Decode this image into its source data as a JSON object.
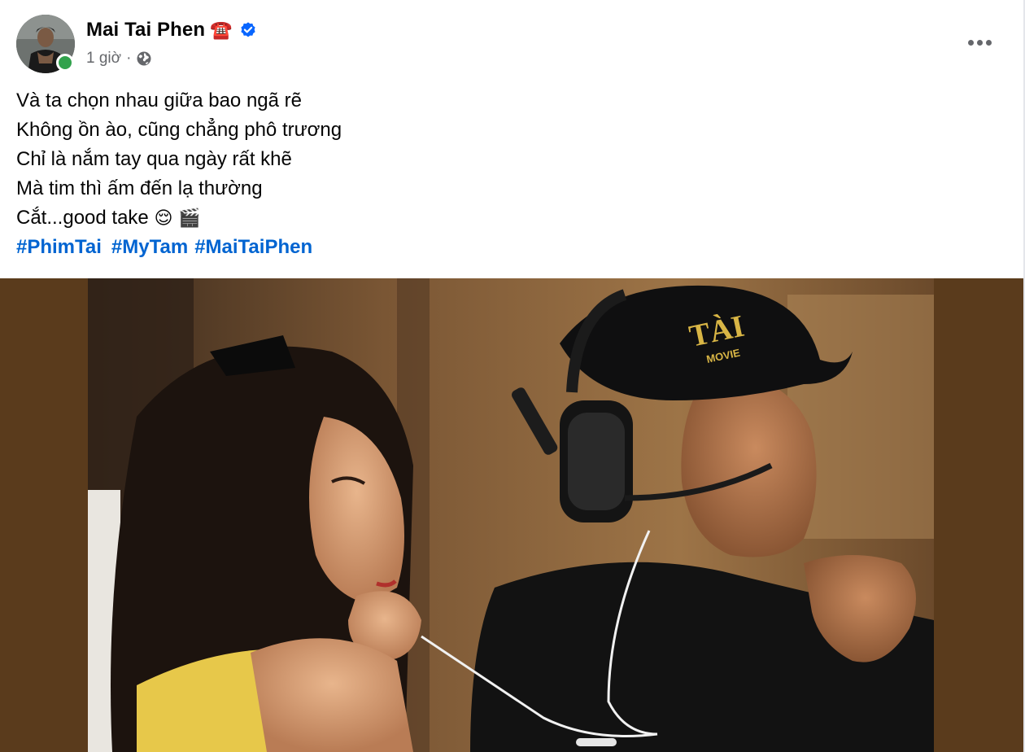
{
  "post": {
    "author": {
      "name": "Mai Tai Phen",
      "name_emoji": "☎️",
      "verified": true,
      "online": true
    },
    "time": "1 giờ",
    "separator": "·",
    "audience_icon": "globe-icon",
    "lines": [
      "Và ta chọn nhau giữa bao ngã rẽ",
      "Không ồn ào, cũng chẳng phô trương",
      "Chỉ là nắm tay qua ngày rất khẽ",
      "Mà tim thì ấm đến lạ thường"
    ],
    "last_line": {
      "text": "Cắt...good take ",
      "emoji_1": "😌",
      "emoji_2": "🎬"
    },
    "hashtags": [
      "#PhimTai",
      "#MyTam",
      "#MaiTaiPhen"
    ],
    "photo": {
      "cap_text_main": "TÀI",
      "cap_text_sub": "MOVIE"
    }
  },
  "colors": {
    "hashtag": "#0064d1",
    "online": "#31a24c",
    "verified": "#0866ff",
    "meta": "#65676b",
    "media_bg": "#5a3b1c"
  }
}
